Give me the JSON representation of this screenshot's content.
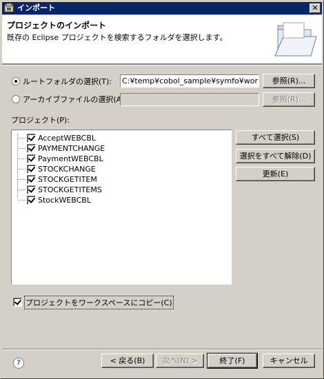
{
  "window": {
    "title": "インポート",
    "close_symbol": "✕"
  },
  "header": {
    "title": "プロジェクトのインポート",
    "description": "既存の Eclipse プロジェクトを検索するフォルダを選択します。"
  },
  "root_folder": {
    "radio_label": "ルートフォルダの選択(T):",
    "value": "C:¥temp¥cobol_sample¥symfo¥workspa",
    "browse_label": "参照(R)..."
  },
  "archive_file": {
    "radio_label": "アーカイブファイルの選択(A):",
    "value": "",
    "browse_label": "参照(R)..."
  },
  "projects": {
    "label": "プロジェクト(P):",
    "items": [
      {
        "name": "AcceptWEBCBL",
        "checked": true
      },
      {
        "name": "PAYMENTCHANGE",
        "checked": true
      },
      {
        "name": "PaymentWEBCBL",
        "checked": true
      },
      {
        "name": "STOCKCHANGE",
        "checked": true
      },
      {
        "name": "STOCKGETITEM",
        "checked": true
      },
      {
        "name": "STOCKGETITEMS",
        "checked": true
      },
      {
        "name": "StockWEBCBL",
        "checked": true
      }
    ],
    "select_all": "すべて選択(S)",
    "deselect_all": "選択をすべて解除(D)",
    "refresh": "更新(E)"
  },
  "copy_option": {
    "label": "プロジェクトをワークスペースにコピー(C)",
    "checked": true
  },
  "footer": {
    "help_symbol": "?",
    "back": "< 戻る(B)",
    "next": "次へ(N) >",
    "finish": "終了(F)",
    "cancel": "キャンセル"
  }
}
